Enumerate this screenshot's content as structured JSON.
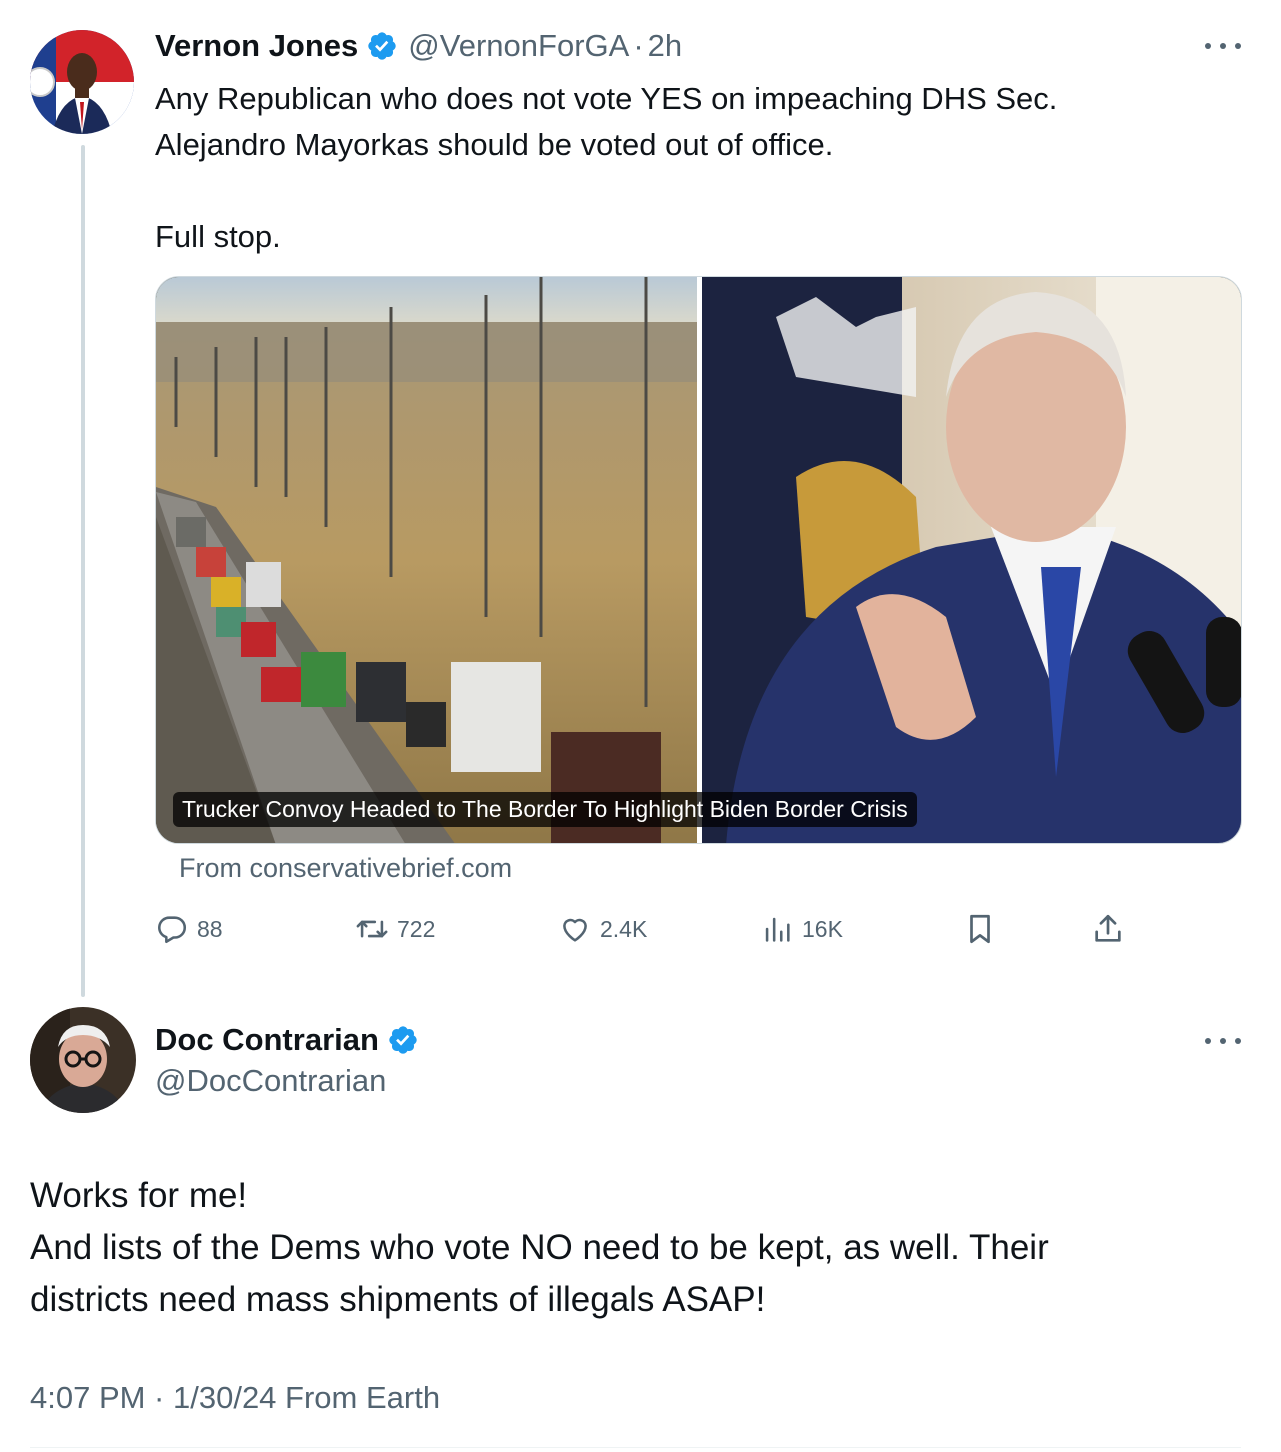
{
  "tweet": {
    "author_name": "Vernon Jones",
    "author_handle": "@VernonForGA",
    "separator": "·",
    "time_ago": "2h",
    "text_lines": [
      "Any Republican who does not vote YES on impeaching DHS Sec.",
      "Alejandro Mayorkas should be voted out of office.",
      "",
      "Full stop."
    ],
    "card": {
      "caption": "Trucker Convoy Headed to The Border To Highlight Biden Border Crisis",
      "source": "From conservativebrief.com"
    },
    "actions": {
      "replies": "88",
      "reposts": "722",
      "likes": "2.4K",
      "views": "16K"
    }
  },
  "reply": {
    "author_name": "Doc Contrarian",
    "author_handle": "@DocContrarian",
    "text_lines": [
      "Works for me!",
      "And lists of the Dems who vote NO need to be kept, as well. Their",
      "districts need mass shipments of illegals ASAP!"
    ],
    "timestamp": "4:07 PM · 1/30/24 From Earth"
  },
  "colors": {
    "text": "#0f1419",
    "secondary": "#536471",
    "verified": "#1d9bf0",
    "thread_line": "#cfd9de"
  },
  "icons": [
    "verified-badge-icon",
    "more-icon",
    "reply-icon",
    "repost-icon",
    "like-icon",
    "views-icon",
    "bookmark-icon",
    "share-icon"
  ]
}
